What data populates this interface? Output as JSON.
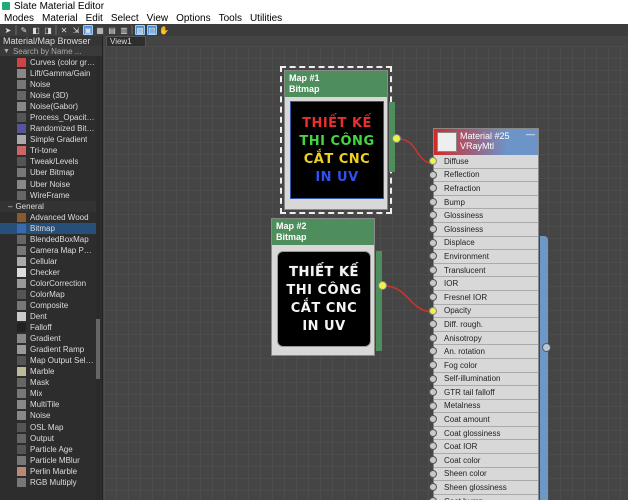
{
  "window": {
    "title": "Slate Material Editor"
  },
  "menu": [
    "Modes",
    "Material",
    "Edit",
    "Select",
    "View",
    "Options",
    "Tools",
    "Utilities"
  ],
  "browser": {
    "title": "Material/Map Browser",
    "search_placeholder": "Search by Name ...",
    "items_top": [
      "Curves (color gradie...",
      "Lift/Gamma/Gain",
      "Noise",
      "Noise (3D)",
      "Noise(Gabor)",
      "Process_OpacityMap",
      "Randomized Bitmaps",
      "Simple Gradient",
      "Tri-tone",
      "Tweak/Levels",
      "Uber Bitmap",
      "Uber Noise",
      "WireFrame"
    ],
    "section": "General",
    "items_general": [
      "Advanced Wood",
      "Bitmap",
      "BlendedBoxMap",
      "Camera Map Per Pixel",
      "Cellular",
      "Checker",
      "ColorCorrection",
      "ColorMap",
      "Composite",
      "Dent",
      "Falloff",
      "Gradient",
      "Gradient Ramp",
      "Map Output Selector",
      "Marble",
      "Mask",
      "Mix",
      "MultiTile",
      "Noise",
      "OSL Map",
      "Output",
      "Particle Age",
      "Particle MBlur",
      "Perlin Marble",
      "RGB Multiply"
    ],
    "selected": "Bitmap"
  },
  "view_tab": "View1",
  "nodes": {
    "map1": {
      "title": "Map #1",
      "subtitle": "Bitmap"
    },
    "map2": {
      "title": "Map #2",
      "subtitle": "Bitmap"
    },
    "vray": {
      "title": "Material #25",
      "subtitle": "VRayMtl"
    }
  },
  "thumbnail_text": [
    "THIẾT KẾ",
    "THI CÔNG",
    "CẮT CNC",
    "IN UV"
  ],
  "slots": [
    "Diffuse",
    "Reflection",
    "Refraction",
    "Bump",
    "Glossiness",
    "Glossiness",
    "Displace",
    "Environment",
    "Translucent",
    "IOR",
    "Fresnel IOR",
    "Opacity",
    "Diff. rough.",
    "Anisotropy",
    "An. rotation",
    "Fog color",
    "Self-illumination",
    "GTR tail falloff",
    "Metalness",
    "Coat amount",
    "Coat glossiness",
    "Coat IOR",
    "Coat color",
    "Sheen color",
    "Sheen glossiness",
    "Coat bump"
  ],
  "connected_slots": [
    "Diffuse",
    "Opacity"
  ],
  "colors": {
    "node_header": "#4d8e5c",
    "selection": "#264f7a",
    "port_active": "#e9f54a",
    "wire": "#d03030"
  }
}
